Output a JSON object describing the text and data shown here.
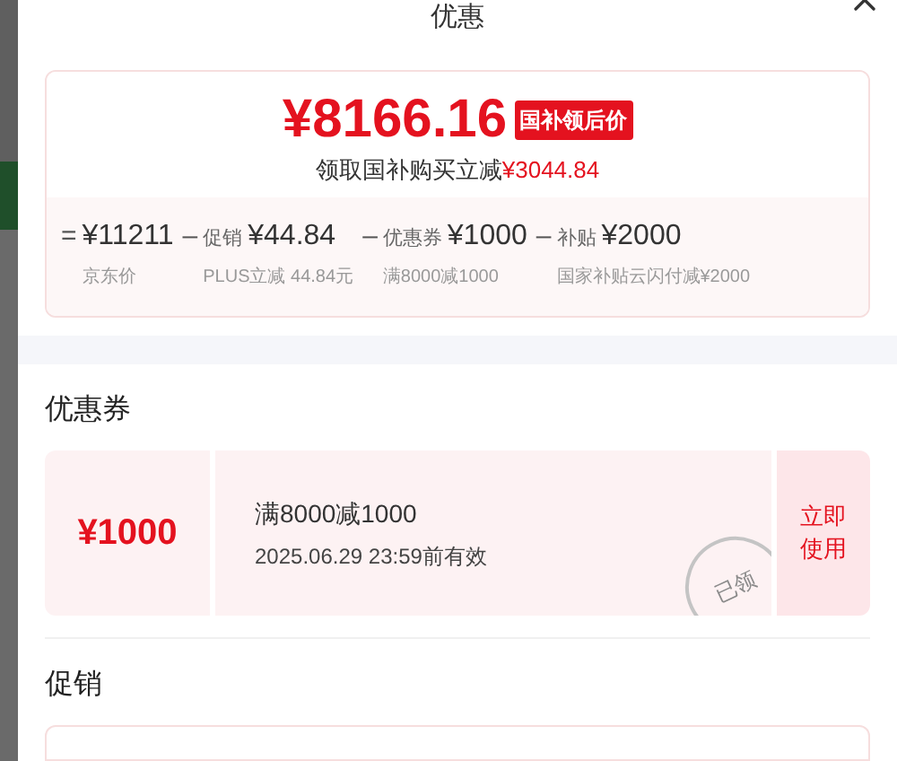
{
  "dialog": {
    "title": "优惠"
  },
  "price_card": {
    "price": "¥8166.16",
    "badge": "国补领后价",
    "summary": "领取国补购买立减",
    "summary_amount": "¥3044.84",
    "breakdown": [
      {
        "op": "=",
        "amount": "¥11211",
        "note": "京东价"
      },
      {
        "op": "–",
        "label": "促销",
        "amount": "¥44.84",
        "note": "PLUS立减 44.84元"
      },
      {
        "op": "–",
        "label": "优惠券",
        "amount": "¥1000",
        "note": "满8000减1000"
      },
      {
        "op": "–",
        "label": "补贴",
        "amount": "¥2000",
        "note": "国家补贴云闪付减¥2000"
      }
    ]
  },
  "sections": [
    {
      "title": "优惠券",
      "coupons": [
        {
          "amount": "¥1000",
          "condition": "满8000减1000",
          "validity": "2025.06.29 23:59前有效",
          "claimed": true,
          "stamp": "已领",
          "action": "立即使用"
        }
      ]
    },
    {
      "title": "促销"
    }
  ]
}
